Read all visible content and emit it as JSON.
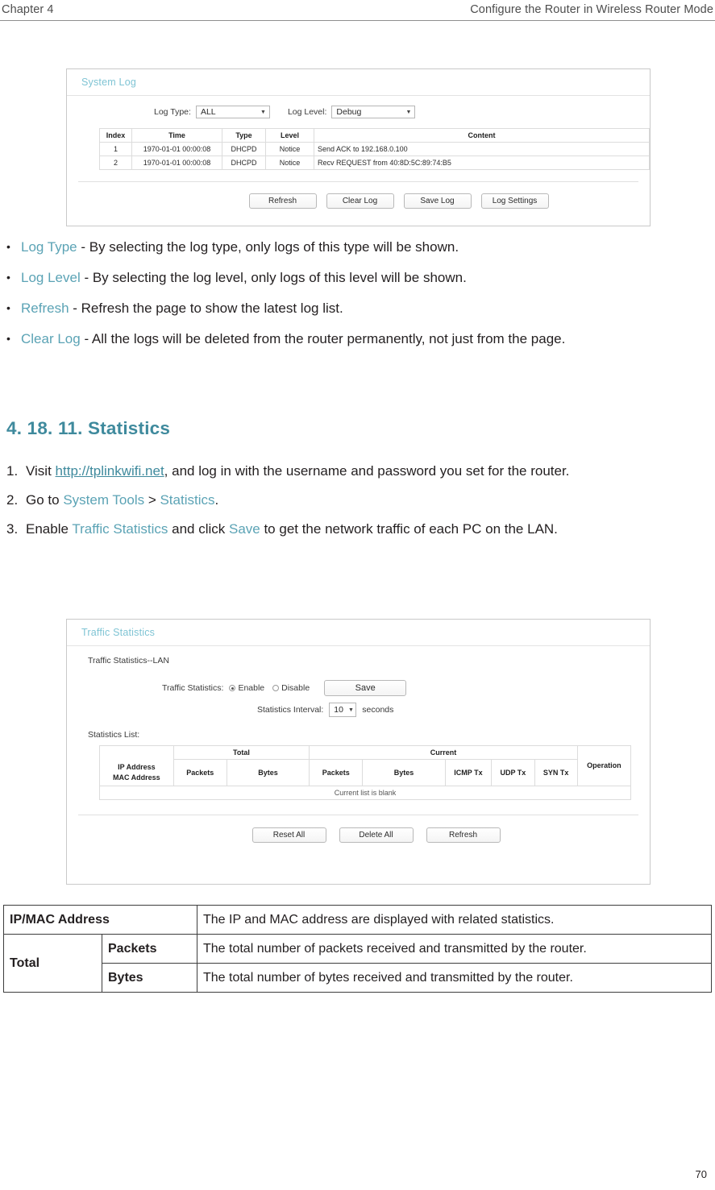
{
  "header": {
    "chapter_label": "Chapter 4",
    "chapter_title": "Configure the Router in Wireless Router Mode"
  },
  "page_number": "70",
  "system_log_panel": {
    "title": "System Log",
    "log_type_label": "Log Type:",
    "log_type_value": "ALL",
    "log_level_label": "Log Level:",
    "log_level_value": "Debug",
    "columns": [
      "Index",
      "Time",
      "Type",
      "Level",
      "Content"
    ],
    "rows": [
      {
        "index": "1",
        "time": "1970-01-01 00:00:08",
        "type": "DHCPD",
        "level": "Notice",
        "content": "Send ACK to 192.168.0.100"
      },
      {
        "index": "2",
        "time": "1970-01-01 00:00:08",
        "type": "DHCPD",
        "level": "Notice",
        "content": "Recv REQUEST from 40:8D:5C:89:74:B5"
      }
    ],
    "buttons": [
      "Refresh",
      "Clear Log",
      "Save Log",
      "Log Settings"
    ]
  },
  "bullets": [
    {
      "term": "Log Type",
      "rest": " - By selecting the log type, only logs of this type will be shown."
    },
    {
      "term": "Log Level",
      "rest": " - By selecting the log level, only logs of this level will be shown."
    },
    {
      "term": "Refresh",
      "rest": " - Refresh the page to show the latest log list."
    },
    {
      "term": "Clear Log",
      "rest": " - All the logs will be deleted from the router permanently, not just from the page."
    }
  ],
  "section": {
    "number": "4. 18. 11.",
    "title": "Statistics",
    "heading_full": "4. 18. 11. Statistics"
  },
  "steps": [
    {
      "marker": "1.",
      "pre": "Visit ",
      "link": "http://tplinkwifi.net",
      "post": ", and log in with the username and password you set for the router."
    },
    {
      "marker": "2.",
      "pre": "Go to ",
      "link1": "System Tools",
      "sep": " > ",
      "link2": "Statistics",
      "post": "."
    },
    {
      "marker": "3.",
      "pre": "Enable ",
      "link1": "Traffic Statistics",
      "mid": " and click ",
      "link2": "Save",
      "post": " to get the network traffic of each PC on the LAN."
    }
  ],
  "traffic_panel": {
    "title": "Traffic Statistics",
    "section_label": "Traffic Statistics--LAN",
    "traffic_statistics_label": "Traffic Statistics:",
    "enable_label": "Enable",
    "disable_label": "Disable",
    "save_label": "Save",
    "interval_label": "Statistics Interval:",
    "interval_value": "10",
    "seconds_label": "seconds",
    "list_label": "Statistics List:",
    "group_headers": [
      "",
      "Total",
      "Current",
      "Operation"
    ],
    "columns": [
      "IP Address\nMAC Address",
      "Packets",
      "Bytes",
      "Packets",
      "Bytes",
      "ICMP Tx",
      "UDP Tx",
      "SYN Tx",
      "Operation"
    ],
    "ip_mac_line1": "IP Address",
    "ip_mac_line2": "MAC Address",
    "total_packets": "Packets",
    "total_bytes": "Bytes",
    "current_packets": "Packets",
    "current_bytes": "Bytes",
    "icmp_tx": "ICMP Tx",
    "udp_tx": "UDP Tx",
    "syn_tx": "SYN Tx",
    "operation": "Operation",
    "total_group": "Total",
    "current_group": "Current",
    "empty_row": "Current list is blank",
    "buttons": [
      "Reset All",
      "Delete All",
      "Refresh"
    ]
  },
  "desc_table": {
    "row_ipmac_label": "IP/MAC Address",
    "row_ipmac_desc": "The IP and MAC address are displayed with related statistics.",
    "total_label": "Total",
    "packets_label": "Packets",
    "packets_desc": "The total number of packets received and transmitted by the router.",
    "bytes_label": "Bytes",
    "bytes_desc": "The total number of bytes received and transmitted by the router."
  },
  "colors": {
    "heading_teal": "#3f8a9d",
    "link_teal": "#5ba3b5",
    "panel_title_teal": "#7fc4d4"
  }
}
